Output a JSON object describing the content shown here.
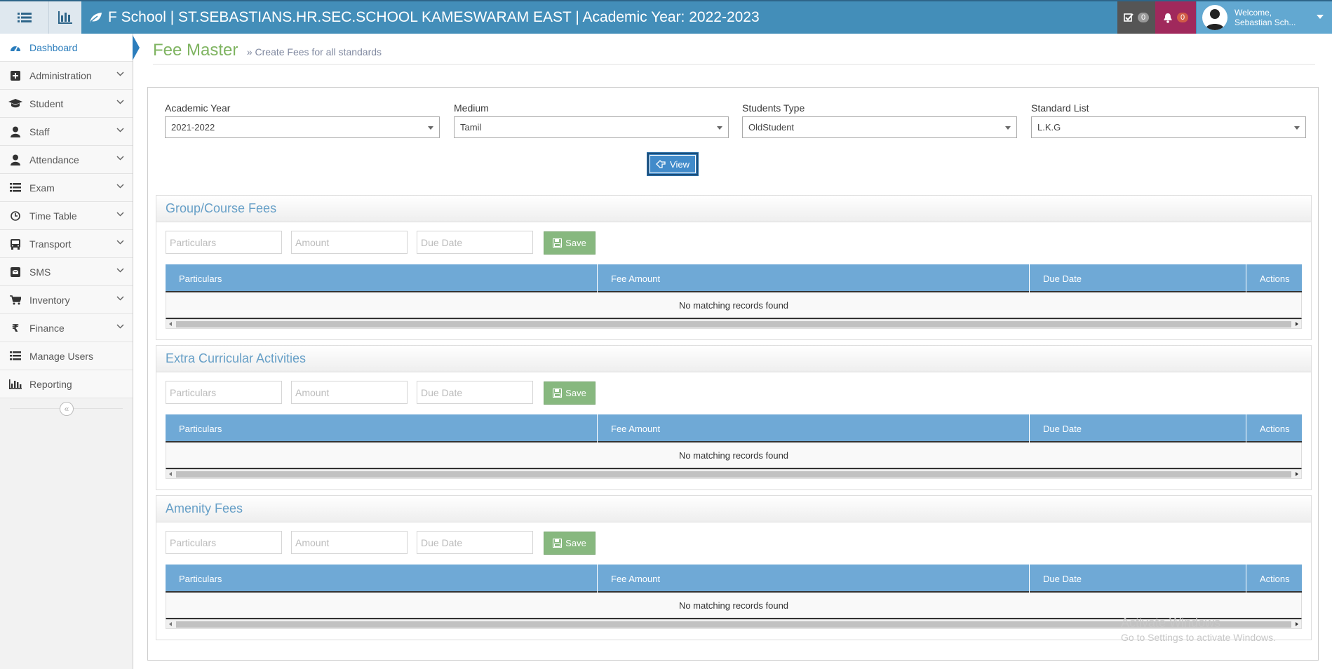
{
  "topbar": {
    "brand": "F School | ST.SEBASTIANS.HR.SEC.SCHOOL KAMESWARAM EAST | Academic Year: 2022-2023",
    "tasks_count": "0",
    "notifications_count": "0",
    "welcome": "Welcome,",
    "user_name": "Sebastian Sch..."
  },
  "sidebar": {
    "items": [
      {
        "label": "Dashboard",
        "icon": "tachometer-icon"
      },
      {
        "label": "Administration",
        "icon": "plus-square-icon"
      },
      {
        "label": "Student",
        "icon": "graduation-cap-icon"
      },
      {
        "label": "Staff",
        "icon": "user-icon"
      },
      {
        "label": "Attendance",
        "icon": "user-icon"
      },
      {
        "label": "Exam",
        "icon": "list-icon"
      },
      {
        "label": "Time Table",
        "icon": "clock-icon"
      },
      {
        "label": "Transport",
        "icon": "bus-icon"
      },
      {
        "label": "SMS",
        "icon": "envelope-icon"
      },
      {
        "label": "Inventory",
        "icon": "cart-icon"
      },
      {
        "label": "Finance",
        "icon": "rupee-icon"
      },
      {
        "label": "Manage Users",
        "icon": "list-icon"
      },
      {
        "label": "Reporting",
        "icon": "bar-chart-icon"
      }
    ],
    "collapse_symbol": "«"
  },
  "page": {
    "title": "Fee Master",
    "subtitle": "» Create Fees for all standards"
  },
  "filters": {
    "academic_year": {
      "label": "Academic Year",
      "value": "2021-2022"
    },
    "medium": {
      "label": "Medium",
      "value": "Tamil"
    },
    "students_type": {
      "label": "Students Type",
      "value": "OldStudent"
    },
    "standard_list": {
      "label": "Standard List",
      "value": "L.K.G"
    },
    "view_label": "View"
  },
  "sections": [
    {
      "title": "Group/Course Fees",
      "particulars_placeholder": "Particulars",
      "amount_placeholder": "Amount",
      "due_date_placeholder": "Due Date",
      "save_label": "Save",
      "columns": [
        "Particulars",
        "Fee Amount",
        "Due Date",
        "Actions"
      ],
      "empty_message": "No matching records found"
    },
    {
      "title": "Extra Curricular Activities",
      "particulars_placeholder": "Particulars",
      "amount_placeholder": "Amount",
      "due_date_placeholder": "Due Date",
      "save_label": "Save",
      "columns": [
        "Particulars",
        "Fee Amount",
        "Due Date",
        "Actions"
      ],
      "empty_message": "No matching records found"
    },
    {
      "title": "Amenity Fees",
      "particulars_placeholder": "Particulars",
      "amount_placeholder": "Amount",
      "due_date_placeholder": "Due Date",
      "save_label": "Save",
      "columns": [
        "Particulars",
        "Fee Amount",
        "Due Date",
        "Actions"
      ],
      "empty_message": "No matching records found"
    }
  ],
  "watermark": {
    "line1": "Activate Windows",
    "line2": "Go to Settings to activate Windows."
  },
  "colors": {
    "navbar": "#438eb9",
    "header_row": "#6fa9d6",
    "save_button": "#87b87f",
    "view_button": "#428bca",
    "title_green": "#7fb461"
  }
}
